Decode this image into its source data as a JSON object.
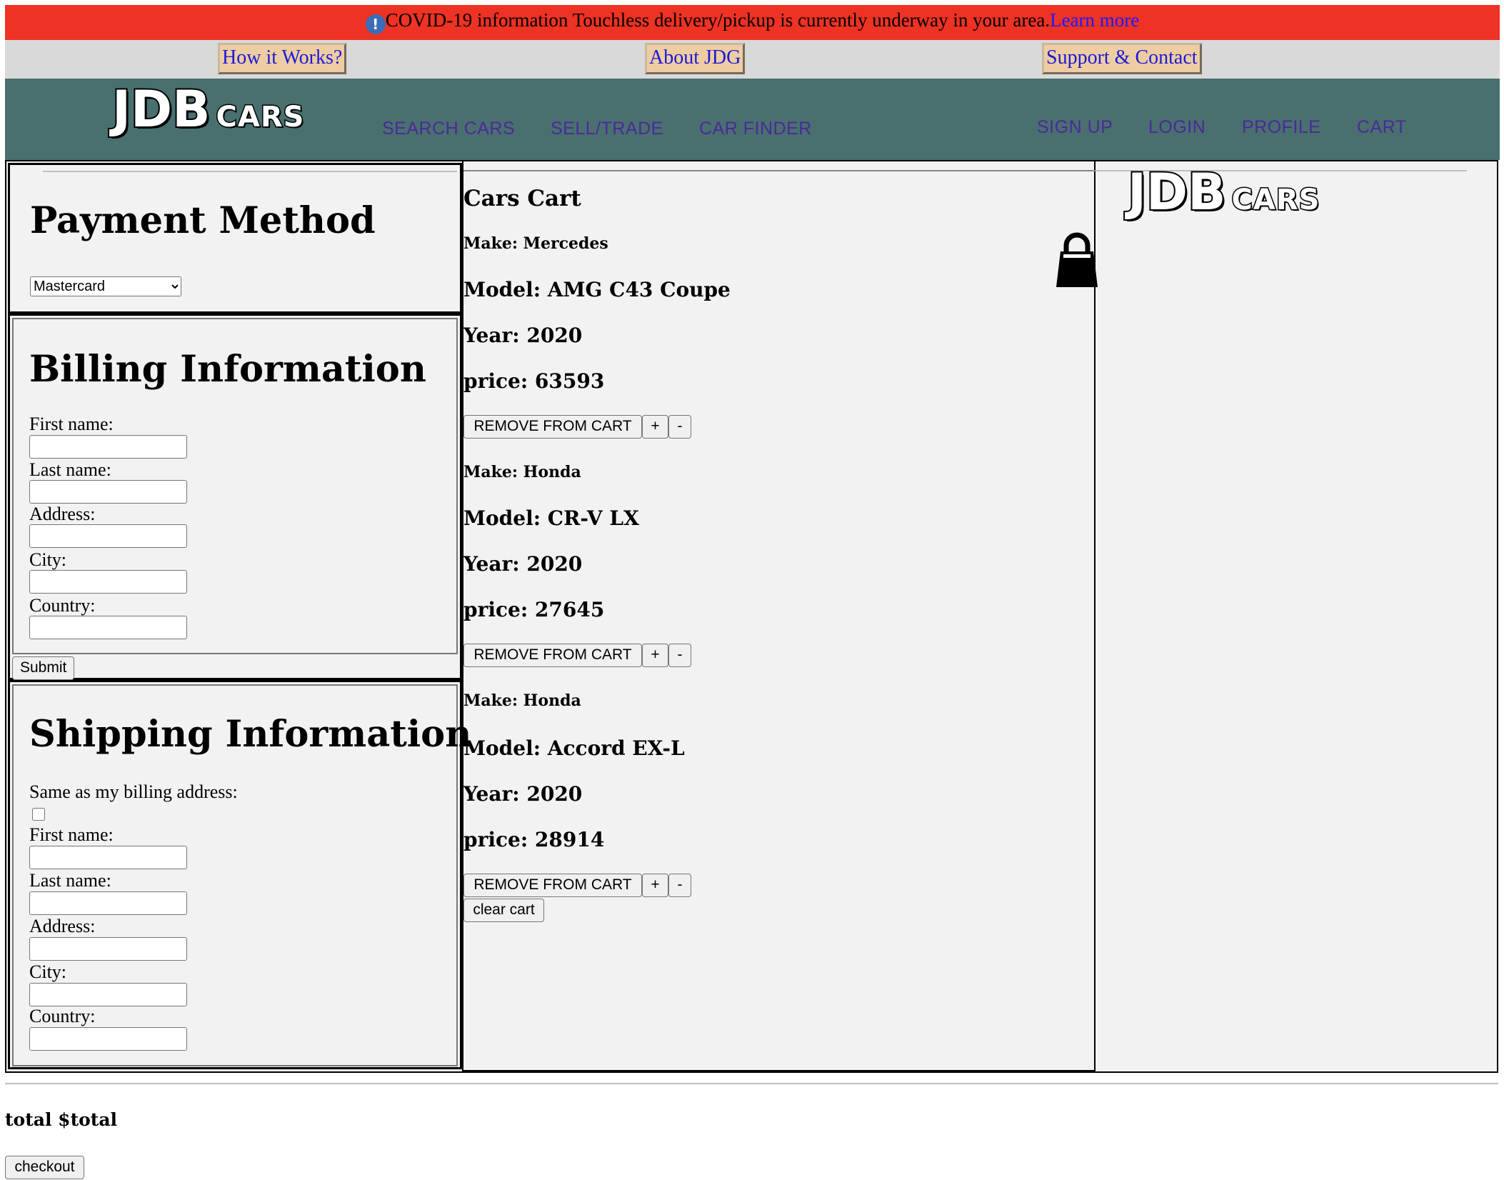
{
  "banner": {
    "icon": "exclamation-circle-icon",
    "text": "COVID-19 information Touchless delivery/pickup is currently underway in your area.",
    "link": "Learn more"
  },
  "subnav": {
    "how_it_works": "How it Works?",
    "about": "About JDG",
    "support": "Support & Contact"
  },
  "header": {
    "logo_big": "JDB",
    "logo_small": "CARS",
    "nav_left": [
      "SEARCH CARS",
      "SELL/TRADE",
      "CAR FINDER"
    ],
    "nav_right": [
      "SIGN UP",
      "LOGIN",
      "PROFILE",
      "CART"
    ]
  },
  "payment": {
    "heading": "Payment Method",
    "selected": "Mastercard"
  },
  "billing": {
    "heading": "Billing Information",
    "fields": [
      "First name:",
      "Last name:",
      "Address:",
      "City:",
      "Country:"
    ],
    "submit": "Submit"
  },
  "shipping": {
    "heading": "Shipping Information",
    "same_label": "Same as my billing address:",
    "same_checked": false,
    "fields": [
      "First name:",
      "Last name:",
      "Address:",
      "City:",
      "Country:"
    ]
  },
  "cart": {
    "title": "Cars Cart",
    "icon": "shopping-bag-icon",
    "remove_label": "REMOVE FROM CART",
    "plus_label": "+",
    "minus_label": "-",
    "clear_label": "clear cart",
    "items": [
      {
        "make": "Make: Mercedes",
        "model": "Model: AMG C43 Coupe",
        "year": "Year: 2020",
        "price": "price: 63593"
      },
      {
        "make": "Make: Honda",
        "model": "Model: CR-V LX",
        "year": "Year: 2020",
        "price": "price: 27645"
      },
      {
        "make": "Make: Honda",
        "model": "Model: Accord EX-L",
        "year": "Year: 2020",
        "price": "price: 28914"
      }
    ]
  },
  "sidebar": {
    "logo_big": "JDB",
    "logo_small": "CARS"
  },
  "footer": {
    "total": "total $total",
    "checkout": "checkout"
  },
  "colors": {
    "banner_bg": "#ee3223",
    "header_bg": "#496f6f",
    "subnav_btn_bg": "#eecda2",
    "nav_link": "#4a2a9a",
    "link_blue": "#1a1aff"
  }
}
